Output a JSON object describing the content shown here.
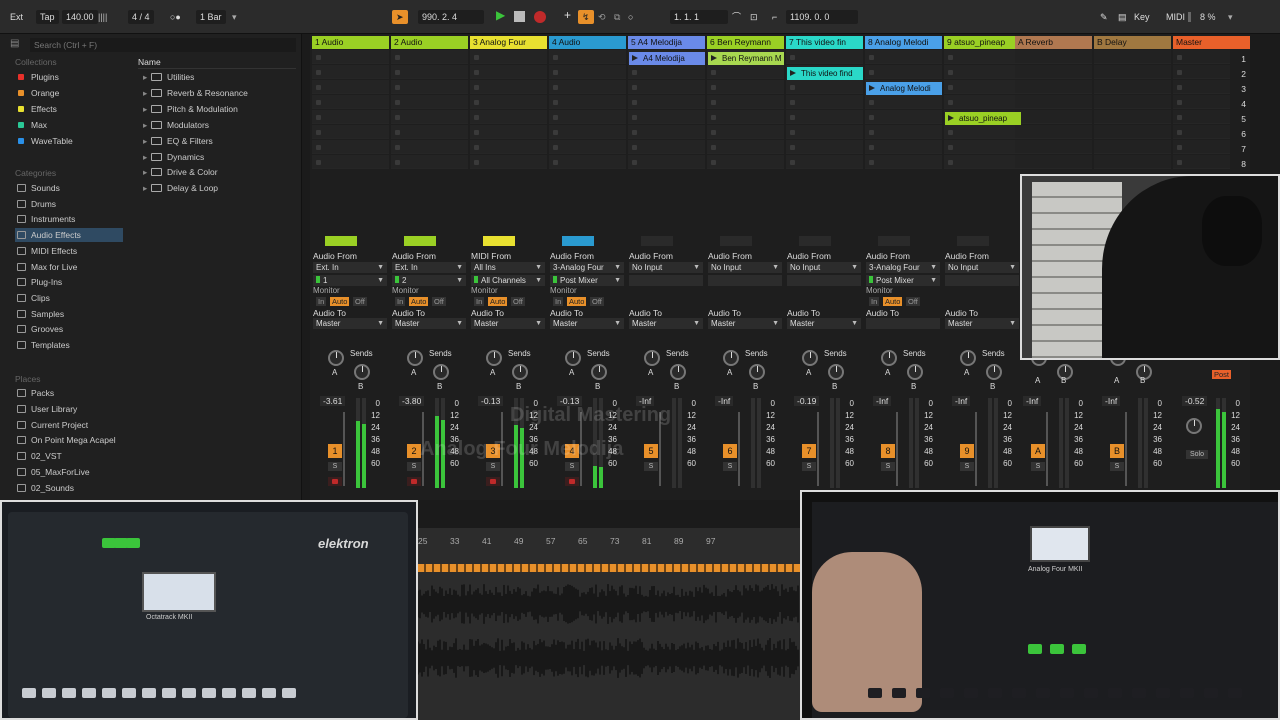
{
  "topbar": {
    "ext": "Ext",
    "tap": "Tap",
    "tempo": "140.00",
    "sig": "4 / 4",
    "quant": "1 Bar",
    "position": "990.  2.  4",
    "loop_start": "1.  1.  1",
    "loop_len": "1109.  0.  0",
    "key": "Key",
    "midi": "MIDI",
    "cpu": "8 %"
  },
  "browser": {
    "search_placeholder": "Search (Ctrl + F)",
    "collections_label": "Collections",
    "collections": [
      {
        "label": "Plugins",
        "color": "#e8302a"
      },
      {
        "label": "Orange",
        "color": "#e8902a"
      },
      {
        "label": "Effects",
        "color": "#e8e030"
      },
      {
        "label": "Max",
        "color": "#2ac896"
      },
      {
        "label": "WaveTable",
        "color": "#2a90e8"
      }
    ],
    "categories_label": "Categories",
    "categories": [
      "Sounds",
      "Drums",
      "Instruments",
      "Audio Effects",
      "MIDI Effects",
      "Max for Live",
      "Plug-Ins",
      "Clips",
      "Samples",
      "Grooves",
      "Templates"
    ],
    "places_label": "Places",
    "places": [
      "Packs",
      "User Library",
      "Current Project",
      "On Point Mega Acapel",
      "02_VST",
      "05_MaxForLive",
      "02_Sounds"
    ],
    "name_header": "Name",
    "folders": [
      "Utilities",
      "Reverb & Resonance",
      "Pitch & Modulation",
      "Modulators",
      "EQ & Filters",
      "Dynamics",
      "Drive & Color",
      "Delay & Loop"
    ]
  },
  "tracks": [
    {
      "name": "1 Audio",
      "color": "#9ad024",
      "from_label": "Audio From",
      "from": "Ext. In",
      "ch": "1",
      "mon": true,
      "to": "Master",
      "vol": "-3.61",
      "num": "1",
      "stop_color": "#9ad024"
    },
    {
      "name": "2 Audio",
      "color": "#9ad024",
      "from_label": "Audio From",
      "from": "Ext. In",
      "ch": "2",
      "mon": true,
      "to": "Master",
      "vol": "-3.80",
      "num": "2",
      "stop_color": "#9ad024"
    },
    {
      "name": "3 Analog Four",
      "color": "#e8e030",
      "from_label": "MIDI From",
      "from": "All Ins",
      "ch": "All Channels",
      "mon": true,
      "to": "Master",
      "vol": "-0.13",
      "num": "3",
      "stop_color": "#e8e030"
    },
    {
      "name": "4 Audio",
      "color": "#2a9ad0",
      "from_label": "Audio From",
      "from": "3-Analog Four",
      "ch": "Post Mixer",
      "mon": true,
      "to": "Master",
      "vol": "-0.13",
      "num": "4",
      "stop_color": "#2a9ad0"
    },
    {
      "name": "5 A4 Melodija",
      "color": "#6a8ae8",
      "from_label": "Audio From",
      "from": "No Input",
      "ch": "",
      "mon": false,
      "to": "Master",
      "vol": "-Inf",
      "num": "5",
      "stop_color": ""
    },
    {
      "name": "6 Ben Reymann",
      "color": "#9ad024",
      "from_label": "Audio From",
      "from": "No Input",
      "ch": "",
      "mon": false,
      "to": "Master",
      "vol": "-Inf",
      "num": "6",
      "stop_color": ""
    },
    {
      "name": "7 This video fin",
      "color": "#2ad8c8",
      "from_label": "Audio From",
      "from": "No Input",
      "ch": "",
      "mon": false,
      "to": "Master",
      "vol": "-0.19",
      "num": "7",
      "stop_color": ""
    },
    {
      "name": "8 Analog Melodi",
      "color": "#4aa0e8",
      "from_label": "Audio From",
      "from": "3-Analog Four",
      "ch": "Post Mixer",
      "mon": true,
      "to": "",
      "vol": "-Inf",
      "num": "8",
      "stop_color": ""
    },
    {
      "name": "9 atsuo_pineap",
      "color": "#9ad024",
      "from_label": "Audio From",
      "from": "No Input",
      "ch": "",
      "mon": false,
      "to": "Master",
      "vol": "-Inf",
      "num": "9",
      "stop_color": ""
    }
  ],
  "returns": [
    {
      "name": "A Reverb",
      "color": "#b07850",
      "vol": "-Inf",
      "num": "A"
    },
    {
      "name": "B Delay",
      "color": "#a07840",
      "vol": "-Inf",
      "num": "B"
    }
  ],
  "master": {
    "name": "Master",
    "color": "#e8602a",
    "vol": "-0.52",
    "post": "Post",
    "solo": "Solo"
  },
  "clips": [
    {
      "track": 4,
      "scene": 0,
      "label": "A4 Melodija",
      "color": "#6a8ae8"
    },
    {
      "track": 5,
      "scene": 0,
      "label": "Ben Reymann M",
      "color": "#a8d850"
    },
    {
      "track": 6,
      "scene": 1,
      "label": "This video find",
      "color": "#2ad8c8"
    },
    {
      "track": 7,
      "scene": 2,
      "label": "Analog Melodi",
      "color": "#4aa0e8"
    },
    {
      "track": 8,
      "scene": 4,
      "label": "atsuo_pineap",
      "color": "#9ad024"
    }
  ],
  "scenes": [
    "1",
    "2",
    "3",
    "4",
    "5",
    "6",
    "7",
    "8"
  ],
  "labels": {
    "monitor": "Monitor",
    "in": "In",
    "auto": "Auto",
    "off": "Off",
    "audio_to": "Audio To",
    "sends": "Sends",
    "send_a": "A",
    "send_b": "B",
    "s": "S",
    "scale": [
      "0",
      "12",
      "24",
      "36",
      "48",
      "60"
    ]
  },
  "arrangement": {
    "ruler": [
      "25",
      "33",
      "41",
      "49",
      "57",
      "65",
      "73",
      "81",
      "89",
      "97"
    ]
  },
  "overlay": {
    "watermark1": "Digital Mastering",
    "watermark2": "Analog Four Melodija"
  },
  "devices": {
    "left_brand": "elektron",
    "left_device": "Octatrack MKII",
    "right_device": "Analog Four MKII"
  }
}
